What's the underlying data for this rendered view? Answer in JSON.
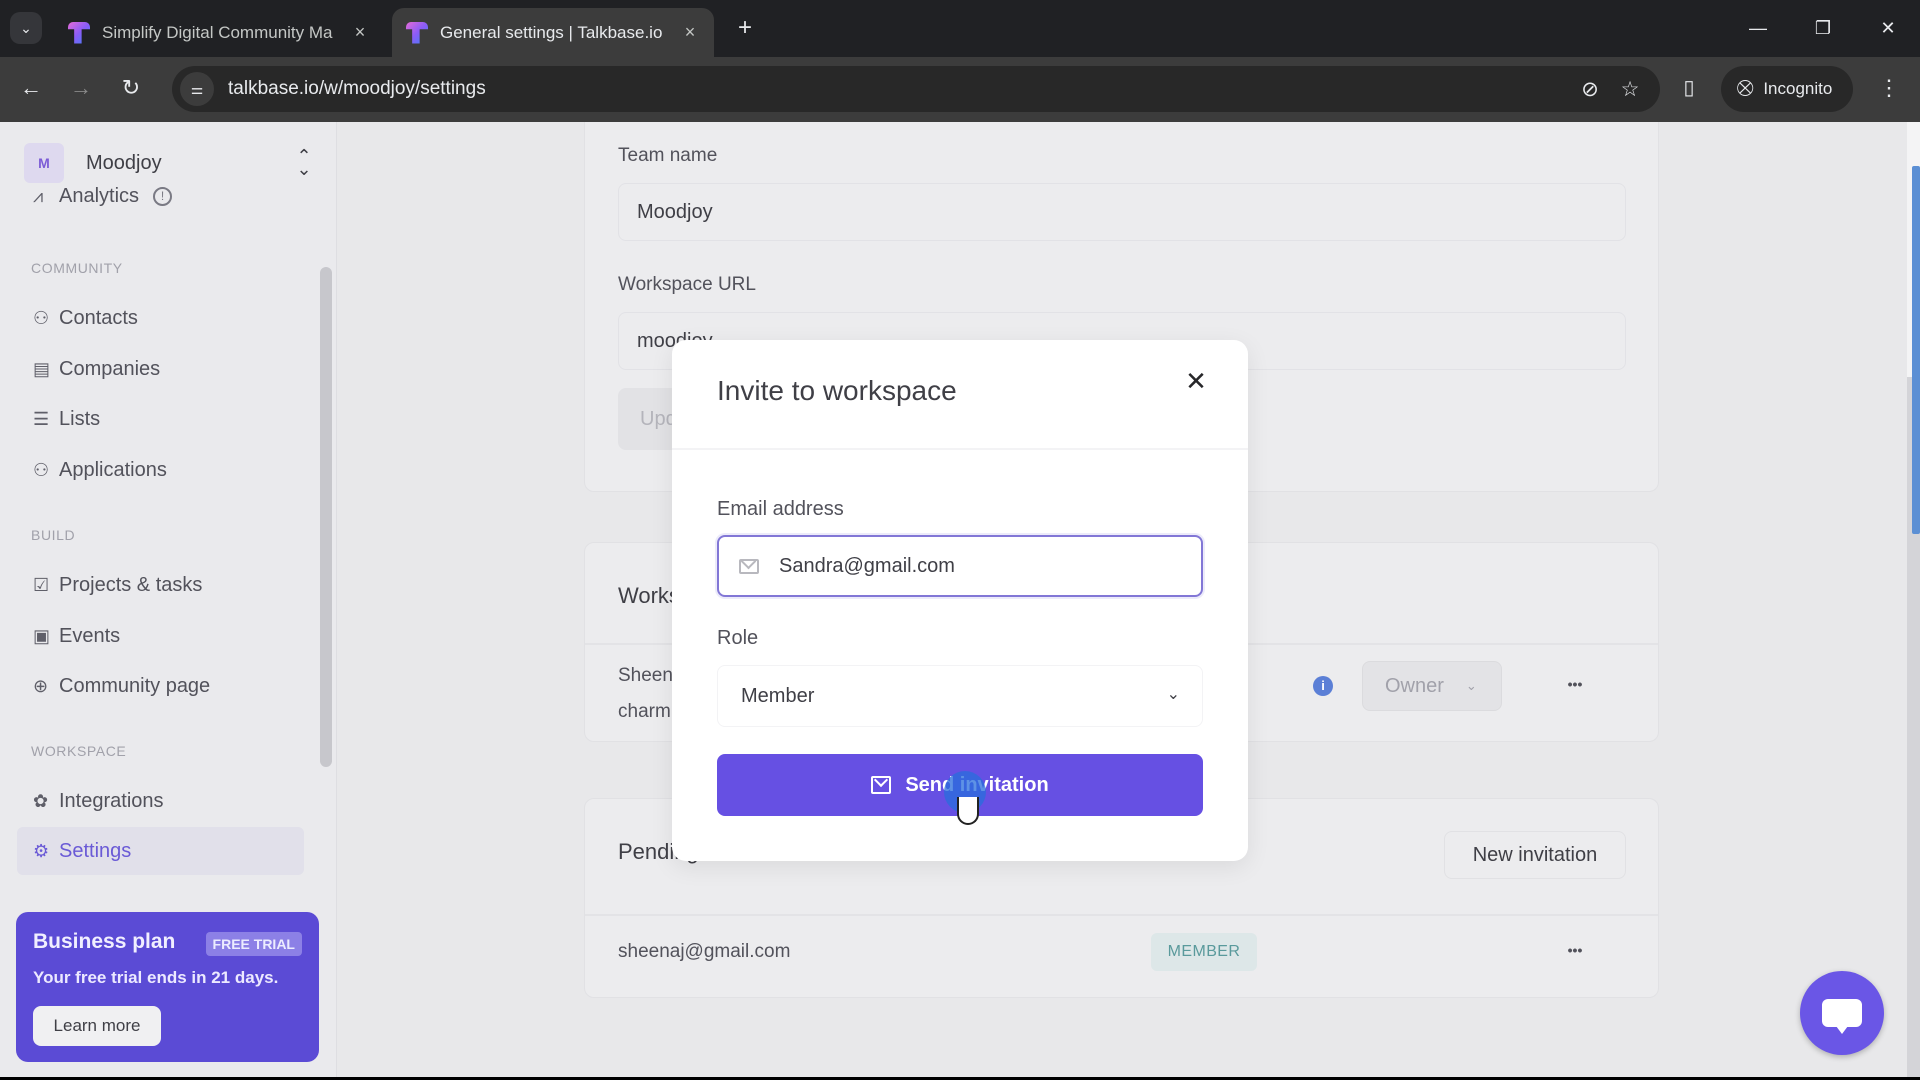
{
  "browser": {
    "tabs": [
      {
        "title": "Simplify Digital Community Ma",
        "active": false
      },
      {
        "title": "General settings | Talkbase.io",
        "active": true
      }
    ],
    "url": "talkbase.io/w/moodjoy/settings",
    "incognito_label": "Incognito",
    "icons": {
      "tab_search": "chevron-down-icon",
      "tab_close": "×",
      "new_tab": "+",
      "back": "←",
      "forward": "→",
      "reload": "↻",
      "site_info": "⚌",
      "eye_off": "⊘",
      "star": "☆",
      "side_panel": "▯",
      "incognito": "🕵",
      "menu": "⋮",
      "minimize": "—",
      "restore": "❐",
      "close": "✕"
    }
  },
  "sidebar": {
    "workspace": {
      "initial": "M",
      "name": "Moodjoy",
      "switch_icon": "⌃⌄"
    },
    "partial_item": {
      "label": "Analytics",
      "icon": "📈"
    },
    "sections": [
      {
        "title": "COMMUNITY",
        "items": [
          {
            "label": "Contacts",
            "icon": "users-icon",
            "glyph": "⚇"
          },
          {
            "label": "Companies",
            "icon": "building-icon",
            "glyph": "▤"
          },
          {
            "label": "Lists",
            "icon": "list-icon",
            "glyph": "☰"
          },
          {
            "label": "Applications",
            "icon": "user-plus-icon",
            "glyph": "⚇"
          }
        ]
      },
      {
        "title": "BUILD",
        "items": [
          {
            "label": "Projects & tasks",
            "icon": "checkbox-icon",
            "glyph": "☑"
          },
          {
            "label": "Events",
            "icon": "calendar-icon",
            "glyph": "▣"
          },
          {
            "label": "Community page",
            "icon": "globe-icon",
            "glyph": "⊕"
          }
        ]
      },
      {
        "title": "WORKSPACE",
        "items": [
          {
            "label": "Integrations",
            "icon": "puzzle-icon",
            "glyph": "✿"
          },
          {
            "label": "Settings",
            "icon": "gear-icon",
            "glyph": "⚙",
            "active": true
          }
        ]
      }
    ],
    "plan": {
      "title": "Business plan",
      "badge": "FREE TRIAL",
      "text": "Your free trial ends in 21 days.",
      "button": "Learn more"
    }
  },
  "main": {
    "general": {
      "team_name_label": "Team name",
      "team_name_value": "Moodjoy",
      "workspace_url_label": "Workspace URL",
      "workspace_url_value": "moodjoy",
      "update_button": "Update"
    },
    "members": {
      "title": "Workspace members",
      "rows": [
        {
          "name": "Sheena",
          "email": "charm",
          "role": "Owner"
        }
      ]
    },
    "pending": {
      "title": "Pending invitations",
      "new_button": "New invitation",
      "rows": [
        {
          "email": "sheenaj@gmail.com",
          "role_badge": "MEMBER"
        }
      ]
    }
  },
  "modal": {
    "title": "Invite to workspace",
    "email_label": "Email address",
    "email_value": "Sandra@gmail.com",
    "role_label": "Role",
    "role_value": "Member",
    "send_button": "Send invitation"
  },
  "colors": {
    "accent": "#6650e3",
    "sidebar_active": "#6a5ad6",
    "plan_card": "#5b4bd5",
    "member_badge_text": "#5a9a9c",
    "info_dot": "#5b7fd6"
  }
}
